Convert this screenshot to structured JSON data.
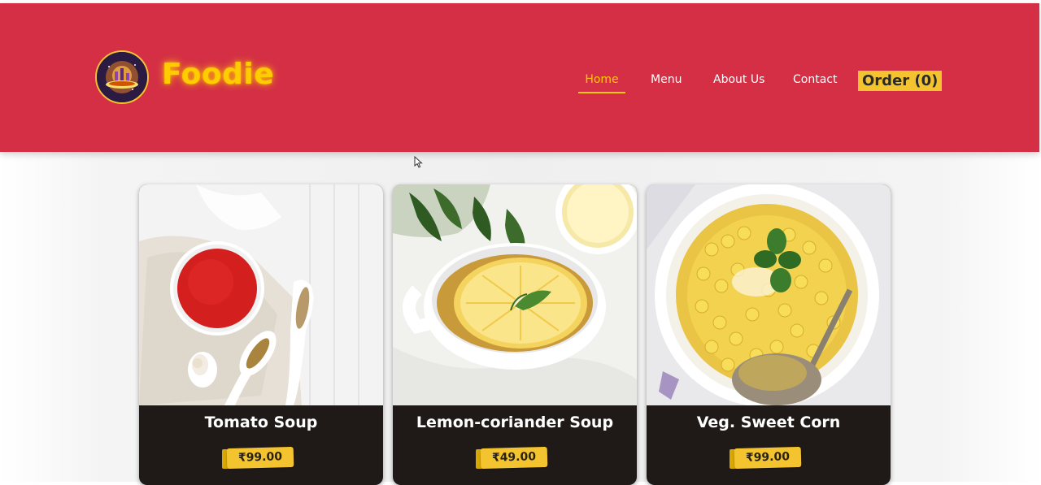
{
  "brand": {
    "name": "Foodie",
    "logo_icon": "foodie-logo-icon"
  },
  "nav": {
    "items": [
      {
        "label": "Home",
        "active": true
      },
      {
        "label": "Menu"
      },
      {
        "label": "About Us"
      },
      {
        "label": "Contact"
      }
    ],
    "order_label": "Order (0)"
  },
  "menu": {
    "items": [
      {
        "name": "Tomato Soup",
        "price": "₹99.00",
        "image": "tomato-soup-photo"
      },
      {
        "name": "Lemon-coriander Soup",
        "price": "₹49.00",
        "image": "lemon-coriander-soup-photo"
      },
      {
        "name": "Veg. Sweet Corn",
        "price": "₹99.00",
        "image": "veg-sweet-corn-photo"
      }
    ]
  },
  "colors": {
    "header_bg": "#d42f45",
    "accent": "#ffcc00",
    "card_bg": "#1f1a18",
    "price_tag": "#f4c430"
  }
}
